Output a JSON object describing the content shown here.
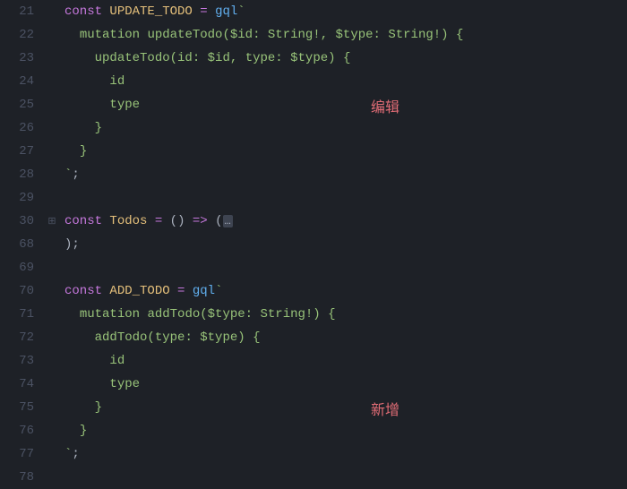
{
  "gutter": [
    "21",
    "22",
    "23",
    "24",
    "25",
    "26",
    "27",
    "28",
    "29",
    "30",
    "68",
    "69",
    "70",
    "71",
    "72",
    "73",
    "74",
    "75",
    "76",
    "77",
    "78"
  ],
  "fold_icons": {
    "line30": "⊞"
  },
  "tokens": {
    "const": "const",
    "UPDATE_TODO": "UPDATE_TODO",
    "eq": "=",
    "gql": "gql",
    "backtick": "`",
    "mutation": "mutation",
    "updateTodo": "updateTodo",
    "lparen": "(",
    "rparen": ")",
    "dollar_id": "$id",
    "dollar_type": "$type",
    "colon": ":",
    "String_bang": "String!",
    "comma": ",",
    "lbrace": "{",
    "rbrace": "}",
    "id": "id",
    "type": "type",
    "Todos": "Todos",
    "arrow": "=>",
    "fold_marker": "…",
    "semi": ";",
    "ADD_TODO": "ADD_TODO",
    "addTodo": "addTodo"
  },
  "annotations": {
    "edit": "编辑",
    "add": "新增"
  }
}
